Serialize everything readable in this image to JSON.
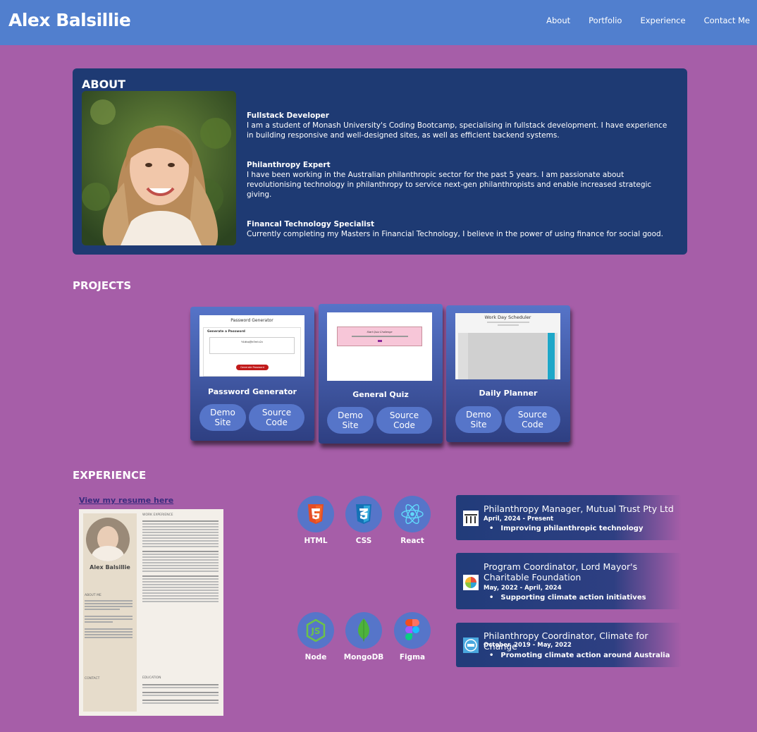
{
  "header": {
    "brand": "Alex Balsillie",
    "nav": [
      "About",
      "Portfolio",
      "Experience",
      "Contact Me"
    ]
  },
  "about": {
    "title": "ABOUT",
    "items": [
      {
        "title": "Fullstack Developer",
        "text": "I am a student of Monash University's Coding Bootcamp, specialising in fullstack development. I have experience in building responsive and well-designed sites, as well as efficient backend systems."
      },
      {
        "title": "Philanthropy Expert",
        "text": "I have been working in the Australian philanthropic sector for the past 5 years. I am passionate about revolutionising technology in philanthropy to service next-gen philanthropists and enable increased strategic giving."
      },
      {
        "title": "Financal Technology Specialist",
        "text": "Currently completing my Masters in Financial Technology, I believe in the power of using finance for social good."
      }
    ]
  },
  "projects": {
    "title": "PROJECTS",
    "cards": [
      {
        "title": "Password Generator",
        "demo": "Demo\nSite",
        "source": "Source\nCode",
        "shot": {
          "heading": "Password Generator",
          "sub": "Generate a Password",
          "field": "Y4#bq@e3m!x2v",
          "button": "Generate Password"
        }
      },
      {
        "title": "General Quiz",
        "demo": "Demo\nSite",
        "source": "Source\nCode",
        "shot": {
          "heading": "Start Quiz Challenge"
        }
      },
      {
        "title": "Daily Planner",
        "demo": "Demo\nSite",
        "source": "Source\nCode",
        "shot": {
          "heading": "Work Day Scheduler"
        }
      }
    ]
  },
  "experience": {
    "title": "EXPERIENCE",
    "resume_link": "View my resume here",
    "resume": {
      "name": "Alex Balsillie",
      "section1": "WORK EXPERIENCE",
      "section2": "ABOUT ME",
      "section3": "EDUCATION",
      "section4": "CONTACT"
    },
    "skills": [
      {
        "name": "HTML",
        "icon": "html5-icon"
      },
      {
        "name": "CSS",
        "icon": "css3-icon"
      },
      {
        "name": "React",
        "icon": "react-icon"
      },
      {
        "name": "Node",
        "icon": "nodejs-icon"
      },
      {
        "name": "MongoDB",
        "icon": "mongodb-icon"
      },
      {
        "name": "Figma",
        "icon": "figma-icon"
      }
    ],
    "jobs": [
      {
        "title": "Philanthropy Manager, Mutual Trust Pty Ltd",
        "dates": "April, 2024 - Present",
        "bullet": "Improving philanthropic technology"
      },
      {
        "title": "Program Coordinator, Lord Mayor's Charitable Foundation",
        "dates": "May, 2022 - April, 2024",
        "bullet": "Supporting climate action initiatives"
      },
      {
        "title": "Philanthropy Coordinator, Climate for Change",
        "dates": "October, 2019 - May, 2022",
        "bullet": "Promoting climate action around Australia"
      }
    ]
  },
  "colors": {
    "page_bg": "#a65ea8",
    "header_bg": "#517fce",
    "panel_bg": "#1e3a73",
    "pill_bg": "#5675c9"
  }
}
